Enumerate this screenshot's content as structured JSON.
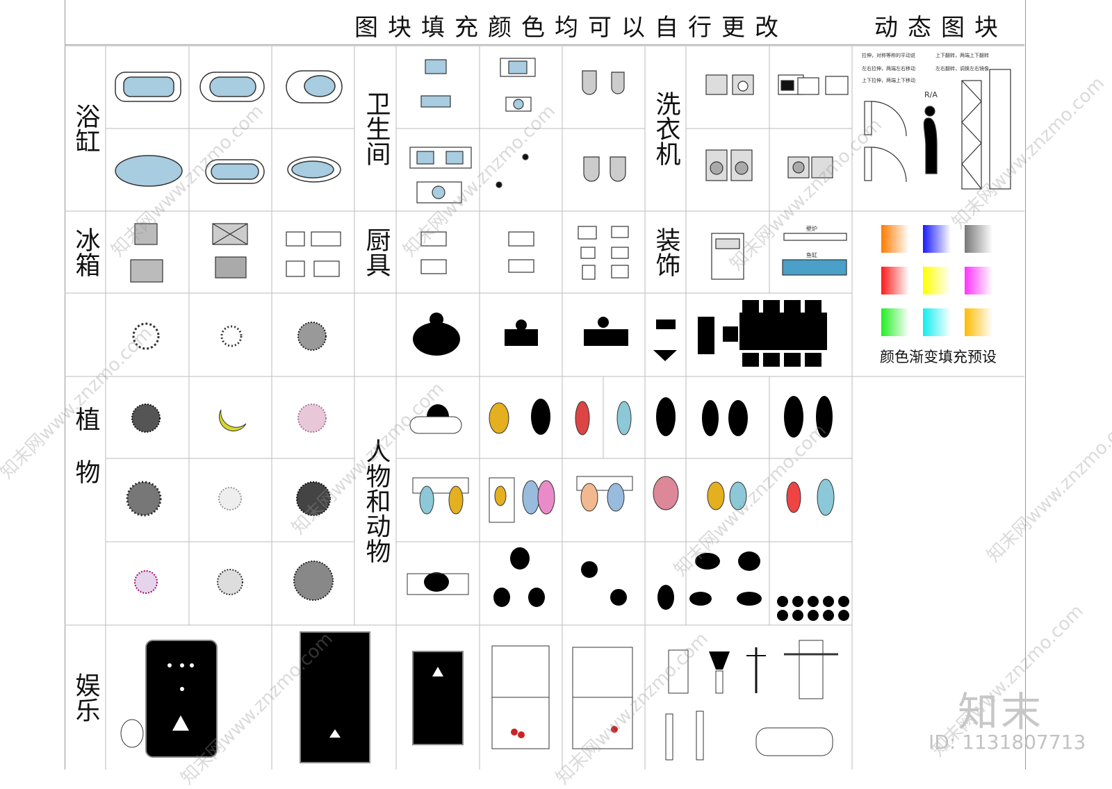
{
  "header": {
    "title": "图块填充颜色均可以自行更改",
    "dynamic": "动态图块"
  },
  "categories": {
    "bathtub": "浴缸",
    "bathroom": "卫生间",
    "washer": "洗衣机",
    "fridge": "冰箱",
    "kitchen": "厨具",
    "decor": "装饰",
    "plants": "植物",
    "people": "人物和动物",
    "entertainment": "娱乐"
  },
  "dynamic_legend": {
    "line1": "拉伸，对称等称的平动说",
    "line2": "左右拉伸，两端左右移动",
    "line3": "上下拉伸，两端上下移动",
    "line4": "上下翻转，两端上下翻转",
    "line5": "左右翻转，调换左右镜像",
    "line6": "上下拉伸，两端上下移动",
    "ra": "R/A"
  },
  "gradient_caption": "颜色渐变填充预设",
  "gradients": [
    "#ff7a00",
    "#1a1aff",
    "#777777",
    "#ff1a1a",
    "#ffff00",
    "#ff33ff",
    "#22ee22",
    "#11eeee",
    "#ffbb00"
  ],
  "kitchen_labels": {
    "a": "壁炉",
    "b": "鱼缸"
  },
  "logo": "知末",
  "id_text": "ID: 1131807713",
  "watermark": "知末网www.znzmo.com",
  "colors": {
    "tub": "#a8cce0",
    "grid": "#bbbbbb",
    "silhouette": "#000000"
  }
}
